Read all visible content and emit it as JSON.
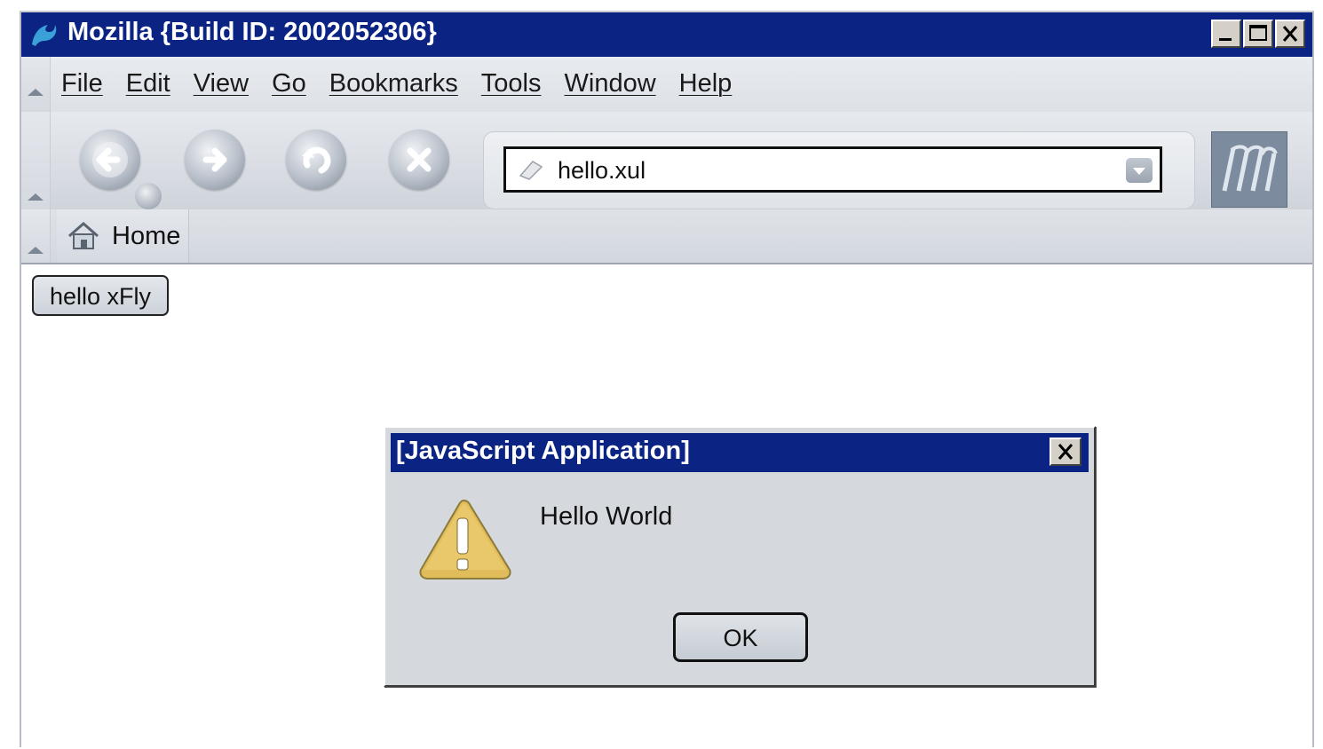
{
  "window": {
    "title": "Mozilla {Build ID: 2002052306}",
    "controls": [
      "minimize-icon",
      "maximize-icon",
      "close-icon"
    ]
  },
  "menubar": {
    "items": [
      {
        "label": "File"
      },
      {
        "label": "Edit"
      },
      {
        "label": "View"
      },
      {
        "label": "Go"
      },
      {
        "label": "Bookmarks"
      },
      {
        "label": "Tools"
      },
      {
        "label": "Window"
      },
      {
        "label": "Help"
      }
    ]
  },
  "navbar": {
    "buttons": [
      "back-icon",
      "forward-icon",
      "reload-icon",
      "stop-icon"
    ],
    "url": "hello.xul"
  },
  "personalbar": {
    "home_label": "Home"
  },
  "content": {
    "button_label": "hello xFly"
  },
  "dialog": {
    "title": "[JavaScript Application]",
    "message": "Hello World",
    "ok_label": "OK",
    "icon": "warning-icon"
  },
  "colors": {
    "titlebar": "#0b2483",
    "chrome": "#dde1e7",
    "dialog_bg": "#d5d9de"
  }
}
